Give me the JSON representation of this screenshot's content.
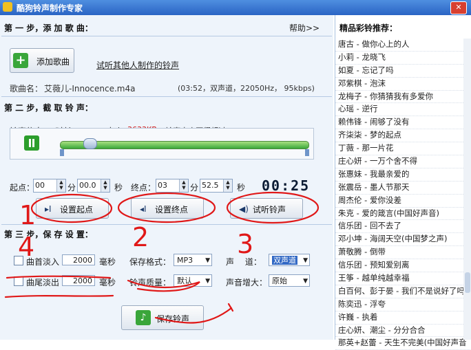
{
  "window": {
    "title": "酷狗铃声制作专家"
  },
  "step1": {
    "heading": "第 一 步，添 加 歌 曲：",
    "help": "帮助>>",
    "add_song": "添加歌曲",
    "try_link": "试听其他人制作的铃声",
    "song_label": "歌曲名：",
    "song_name": "艾薇儿-Innocence.m4a",
    "song_info": "(03:52，双声道，22050Hz，  95kbps)"
  },
  "step2": {
    "heading": "第 二 步，截 取 铃 声：",
    "info_label": "铃声信息：",
    "info_time": "时长 03:52，大小",
    "info_size": "3633KB",
    "info_limit": "(铃声大小不得超过2.0M)",
    "start_label": "起点：",
    "start_min": "00",
    "min_unit": "分",
    "start_sec": "00.0",
    "sec_unit": "秒",
    "end_label": "终点：",
    "end_min": "03",
    "end_sec": "52.5",
    "time_display": "00:25",
    "set_start": "设置起点",
    "set_end": "设置终点",
    "preview": "试听铃声",
    "position_fraction": 0.1
  },
  "step3": {
    "heading": "第 三 步，保 存 设 置：",
    "fade_in": "曲首淡入",
    "fade_in_val": "2000",
    "fade_out": "曲尾淡出",
    "fade_out_val": "2000",
    "ms_unit": "毫秒",
    "format_label": "保存格式：",
    "format_val": "MP3",
    "channel_label": "声　 道：",
    "channel_val": "双声道",
    "quality_label": "铃声质量：",
    "quality_val": "默认",
    "volume_label": "声音增大：",
    "volume_val": "原始",
    "save": "保存铃声"
  },
  "recommend": {
    "title": "精品彩铃推荐：",
    "items": [
      "唐古 - 做你心上的人",
      "小莉 - 龙晓飞",
      "如夏 - 忘记了吗",
      "邓紫棋 - 泡沫",
      "龙梅子 - 你猜猜我有多爱你",
      "心瑶 - 逆行",
      "赖伟锋 - 闹够了没有",
      "齐柒柒 - 梦的起点",
      "丁薇 - 那一片花",
      "庄心妍 - 一万个舍不得",
      "张惠妹 - 我最亲爱的",
      "张震岳 - 墨人节那天",
      "周杰伦 - 爱你没差",
      "朱克 - 爱的箴言(中国好声音)",
      "信乐团 - 回不去了",
      "邓小坤 - 海阔天空(中国梦之声)",
      "萧敬腾 - 倒带",
      "信乐团 - 预知爱别离",
      "王筝 - 越单纯越幸福",
      "白百何、彭于晏 - 我们不是说好了吗",
      "陈奕迅 - 浮夸",
      "许巍 - 执着",
      "庄心妍、潮尘 - 分分合合",
      "那英+赵蕾 - 天生不完美(中国好声音"
    ]
  },
  "annotations": [
    "1",
    "2",
    "3",
    "4"
  ],
  "colors": {
    "accent": "#2a64c4",
    "ink": "#e01818",
    "size_red": "#d01010"
  }
}
